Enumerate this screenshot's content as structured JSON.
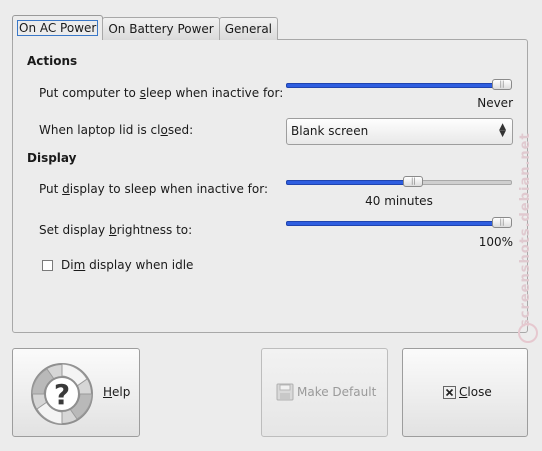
{
  "tabs": [
    {
      "label": "On AC Power",
      "active": true
    },
    {
      "label": "On Battery Power",
      "active": false
    },
    {
      "label": "General",
      "active": false
    }
  ],
  "actions": {
    "heading": "Actions",
    "sleep_pre": "Put computer to ",
    "sleep_u": "s",
    "sleep_post": "leep when inactive for:",
    "sleep_slider_value": 1.0,
    "sleep_value_text": "Never",
    "lid_pre": "When laptop lid is cl",
    "lid_u": "o",
    "lid_post": "sed:",
    "lid_selected": "Blank screen"
  },
  "display": {
    "heading": "Display",
    "dsleep_pre": "Put ",
    "dsleep_u": "d",
    "dsleep_post": "isplay to sleep when inactive for:",
    "dsleep_slider_value": 0.57,
    "dsleep_value_text": "40 minutes",
    "bright_pre": "Set display ",
    "bright_u": "b",
    "bright_post": "rightness to:",
    "bright_slider_value": 1.0,
    "bright_value_text": "100%",
    "dim_pre": "Di",
    "dim_u": "m",
    "dim_post": " display when idle",
    "dim_checked": false
  },
  "buttons": {
    "help_u": "H",
    "help_post": "elp",
    "make_default": "Make Default",
    "close_u": "C",
    "close_post": "lose"
  },
  "watermark": "screenshots.debian.net",
  "colors": {
    "accent": "#2e5ee0",
    "focus": "#3a78c8"
  }
}
